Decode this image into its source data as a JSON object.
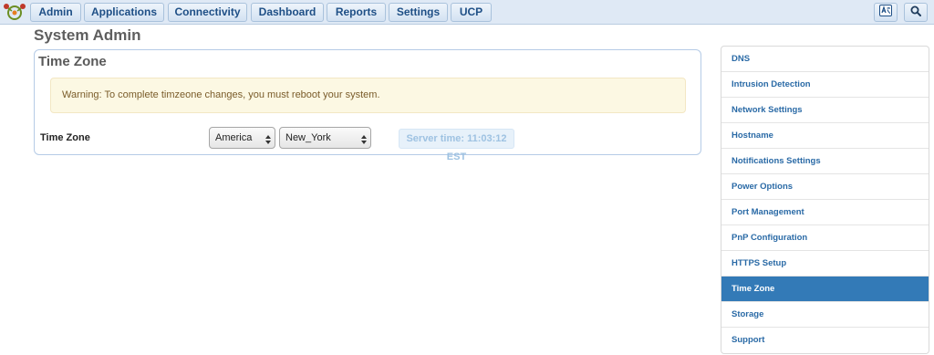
{
  "nav": {
    "items": [
      {
        "label": "Admin"
      },
      {
        "label": "Applications"
      },
      {
        "label": "Connectivity"
      },
      {
        "label": "Dashboard"
      },
      {
        "label": "Reports"
      },
      {
        "label": "Settings"
      },
      {
        "label": "UCP"
      }
    ],
    "icons": [
      "language-icon",
      "search-icon"
    ]
  },
  "page": {
    "title": "System Admin"
  },
  "panel": {
    "title": "Time Zone",
    "warning": "Warning: To complete timzeone changes, you must reboot your system.",
    "field_label": "Time Zone",
    "region_value": "America",
    "city_value": "New_York",
    "server_time": "Server time: 11:03:12 EST"
  },
  "side_menu": {
    "items": [
      {
        "label": "DNS"
      },
      {
        "label": "Intrusion Detection"
      },
      {
        "label": "Network Settings"
      },
      {
        "label": "Hostname"
      },
      {
        "label": "Notifications Settings"
      },
      {
        "label": "Power Options"
      },
      {
        "label": "Port Management"
      },
      {
        "label": "PnP Configuration"
      },
      {
        "label": "HTTPS Setup"
      },
      {
        "label": "Time Zone"
      },
      {
        "label": "Storage"
      },
      {
        "label": "Support"
      }
    ],
    "active": "Time Zone"
  },
  "colors": {
    "accent": "#337ab7",
    "nav_bg": "#dfe9f5",
    "warning_bg": "#fcf8e3"
  }
}
